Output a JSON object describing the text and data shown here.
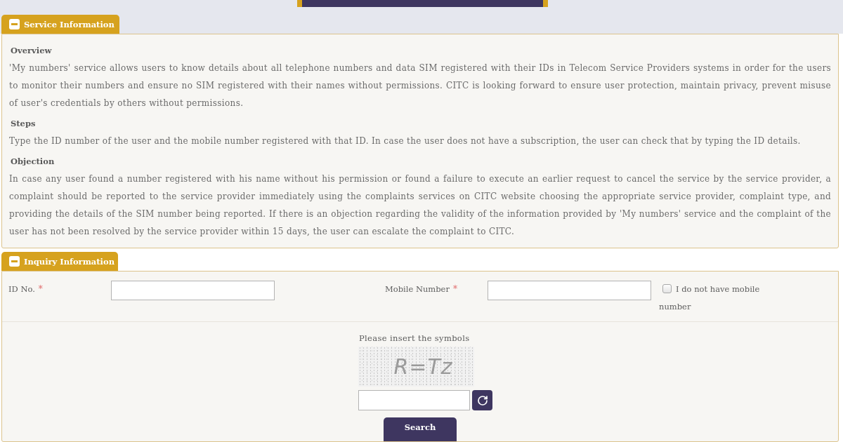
{
  "service_information": {
    "title": "Service Information",
    "expanded": true,
    "sections": [
      {
        "heading": "Overview",
        "text": "'My numbers' service allows users to know details about all telephone numbers and data SIM registered with their IDs in Telecom Service Providers systems in order for the users to monitor their numbers and ensure no SIM registered with their names without permissions. CITC is looking forward to ensure user protection, maintain privacy, prevent misuse of user's credentials by others without permissions."
      },
      {
        "heading": "Steps",
        "text": "Type the ID number of the user and the mobile number registered with that ID. In case the user does not have a subscription, the user can check that by typing the ID details."
      },
      {
        "heading": "Objection",
        "text": "In case any user found a number registered with his name without his permission or found a failure to execute an earlier request to cancel the service by the service provider, a complaint should be reported to the service provider immediately using the complaints services on CITC website choosing the appropriate service provider, complaint type, and providing the details of the SIM number being reported. If there is an objection regarding the validity of the information provided by 'My numbers' service and the complaint of the user has not been resolved by the service provider within 15 days, the user can escalate the complaint to CITC."
      }
    ]
  },
  "inquiry_information": {
    "title": "Inquiry Information",
    "expanded": true,
    "fields": [
      {
        "label": "ID No.",
        "required_mark": "*"
      },
      {
        "label": "Mobile Number",
        "required_mark": "*"
      }
    ],
    "no_mobile": {
      "label": "I do not have mobile number",
      "checked": false
    },
    "captcha": {
      "prompt": "Please insert the symbols",
      "symbols": "R=Tz"
    },
    "search_button": "Search"
  }
}
